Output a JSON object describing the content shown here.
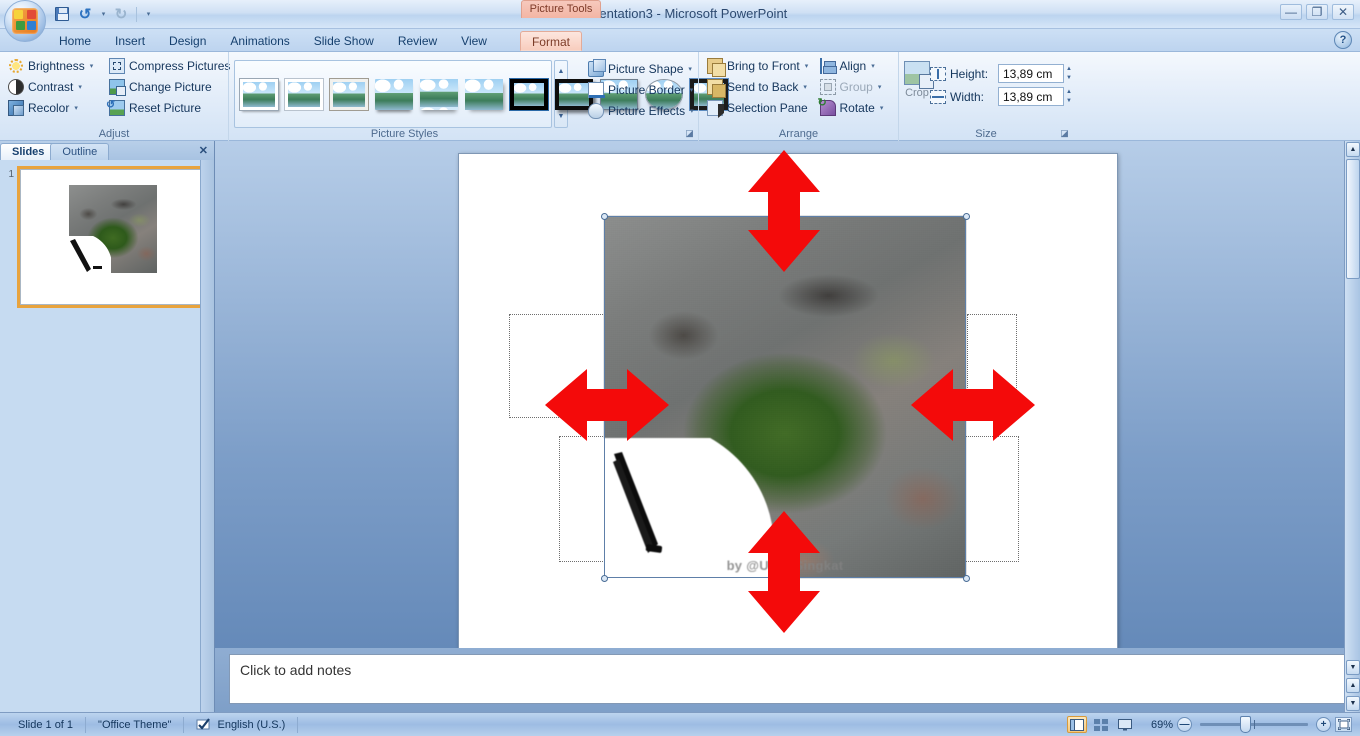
{
  "window": {
    "title": "Presentation3  -  Microsoft PowerPoint",
    "contextual_tab_label": "Picture Tools",
    "minimize": "—",
    "restore": "❐",
    "close": "✕",
    "help": "?"
  },
  "quick_access": {
    "save": "save-icon",
    "undo": "↺",
    "undo_caret": "▾",
    "redo": "↻",
    "customize_caret": "▾"
  },
  "tabs": [
    {
      "label": "Home",
      "active": false
    },
    {
      "label": "Insert",
      "active": false
    },
    {
      "label": "Design",
      "active": false
    },
    {
      "label": "Animations",
      "active": false
    },
    {
      "label": "Slide Show",
      "active": false
    },
    {
      "label": "Review",
      "active": false
    },
    {
      "label": "View",
      "active": false
    },
    {
      "label": "Format",
      "active": true
    }
  ],
  "ribbon": {
    "adjust": {
      "label": "Adjust",
      "items": [
        {
          "label": "Brightness",
          "caret": "▾",
          "icon": "brightness-icon",
          "disabled": false
        },
        {
          "label": "Contrast",
          "caret": "▾",
          "icon": "contrast-icon",
          "disabled": false
        },
        {
          "label": "Recolor",
          "caret": "▾",
          "icon": "recolor-icon",
          "disabled": false
        },
        {
          "label": "Compress Pictures",
          "caret": "",
          "icon": "compress-pictures-icon",
          "disabled": false
        },
        {
          "label": "Change Picture",
          "caret": "",
          "icon": "change-picture-icon",
          "disabled": false
        },
        {
          "label": "Reset Picture",
          "caret": "",
          "icon": "reset-picture-icon",
          "disabled": false
        }
      ]
    },
    "picture_styles": {
      "label": "Picture Styles",
      "gallery_count": 11,
      "scroll_up": "▲",
      "scroll_down": "▼",
      "more": "▼",
      "dialog_launcher": "◪",
      "items": [
        {
          "label": "Picture Shape",
          "caret": "▾",
          "icon": "picture-shape-icon"
        },
        {
          "label": "Picture Border",
          "caret": "▾",
          "icon": "picture-border-icon"
        },
        {
          "label": "Picture Effects",
          "caret": "▾",
          "icon": "picture-effects-icon"
        }
      ]
    },
    "arrange": {
      "label": "Arrange",
      "items": [
        {
          "label": "Bring to Front",
          "caret": "▾",
          "icon": "bring-to-front-icon",
          "disabled": false
        },
        {
          "label": "Send to Back",
          "caret": "▾",
          "icon": "send-to-back-icon",
          "disabled": false
        },
        {
          "label": "Selection Pane",
          "caret": "",
          "icon": "selection-pane-icon",
          "disabled": false
        },
        {
          "label": "Align",
          "caret": "▾",
          "icon": "align-icon",
          "disabled": false
        },
        {
          "label": "Group",
          "caret": "▾",
          "icon": "group-icon",
          "disabled": true
        },
        {
          "label": "Rotate",
          "caret": "▾",
          "icon": "rotate-icon",
          "disabled": false
        }
      ]
    },
    "size": {
      "label": "Size",
      "crop_label": "Crop",
      "height_label": "Height:",
      "height_value": "13,89 cm",
      "width_label": "Width:",
      "width_value": "13,89 cm",
      "dialog_launcher": "◪",
      "spin_up": "▲",
      "spin_down": "▼"
    }
  },
  "left_pane": {
    "tab_slides": "Slides",
    "tab_outline": "Outline",
    "close": "✕",
    "slide_number": "1"
  },
  "slide": {
    "picture_watermark": "by @UmorSingkat",
    "arrows": [
      {
        "name": "resize-arrow-up-down-top",
        "direction": "vertical"
      },
      {
        "name": "resize-arrow-left-right-left",
        "direction": "horizontal"
      },
      {
        "name": "resize-arrow-left-right-right",
        "direction": "horizontal"
      },
      {
        "name": "resize-arrow-up-down-bottom",
        "direction": "vertical"
      }
    ],
    "arrow_color": "#f40a0a",
    "selection_handle_fill": "#dbe8f6",
    "selection_handle_stroke": "#4a6d96",
    "rotation_handle_color": "#7ac943"
  },
  "notes": {
    "placeholder": "Click to add notes"
  },
  "status_bar": {
    "slide_counter": "Slide 1 of 1",
    "theme": "\"Office Theme\"",
    "spellcheck_icon": "spellcheck-icon",
    "language": "English (U.S.)",
    "zoom_level": "69%",
    "zoom_out": "—",
    "zoom_in": "+",
    "fit_to_window": "fit-slide-icon",
    "views": [
      {
        "name": "normal-view",
        "icon": "▤",
        "active": true
      },
      {
        "name": "slide-sorter-view",
        "icon": "▦",
        "active": false
      },
      {
        "name": "slide-show-view",
        "icon": "▭",
        "active": false
      }
    ]
  }
}
